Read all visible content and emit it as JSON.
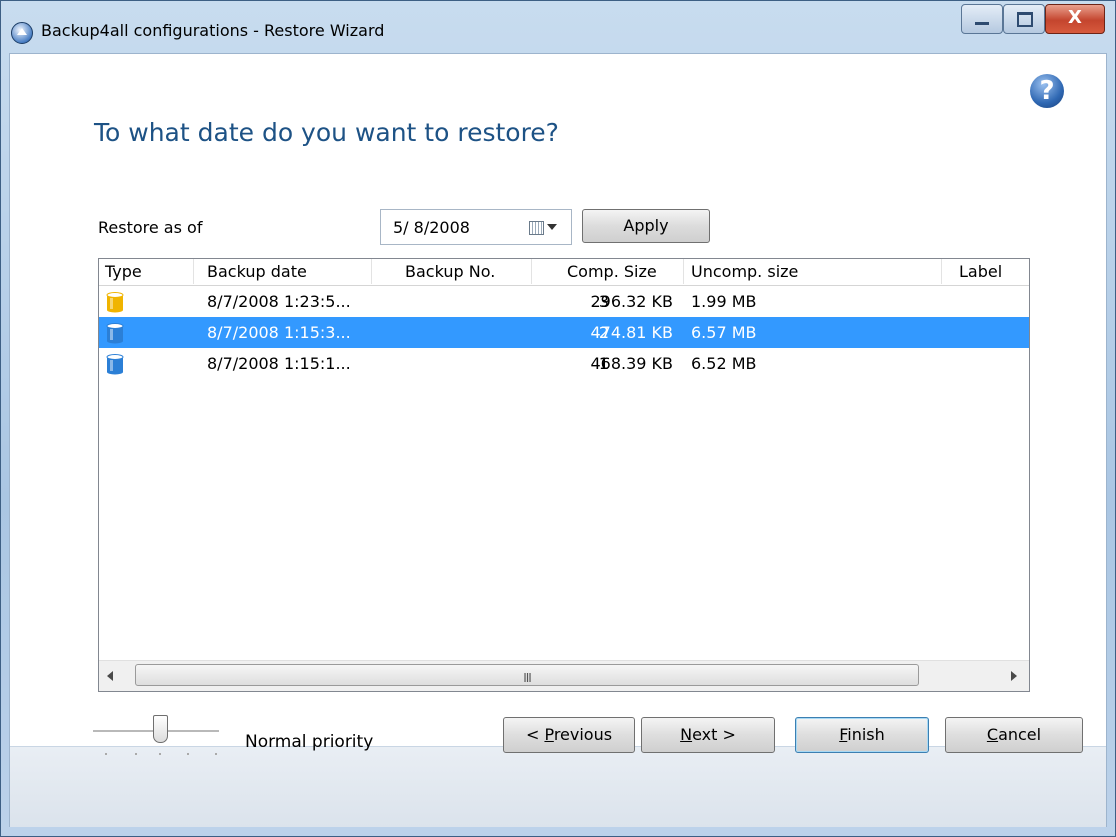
{
  "window": {
    "title": "Backup4all configurations - Restore Wizard",
    "close_symbol": "X"
  },
  "help": {
    "symbol": "?"
  },
  "page": {
    "heading": "To what date do you want to restore?"
  },
  "restore": {
    "label": "Restore as of",
    "date_value": "5/ 8/2008",
    "apply_label": "Apply"
  },
  "list": {
    "columns": [
      "Type",
      "Backup date",
      "Backup No.",
      "Comp. Size",
      "Uncomp. size",
      "Label"
    ],
    "rows": [
      {
        "type_icon": "database-icon",
        "backup_date": "8/7/2008 1:23:5...",
        "backup_no": "3",
        "comp_size": "296.32 KB",
        "uncomp_size": "1.99 MB",
        "label": "",
        "selected": false,
        "icon_color": "#f0b400"
      },
      {
        "type_icon": "database-icon",
        "backup_date": "8/7/2008 1:15:3...",
        "backup_no": "2",
        "comp_size": "474.81 KB",
        "uncomp_size": "6.57 MB",
        "label": "",
        "selected": true,
        "icon_color": "#2b7fd6"
      },
      {
        "type_icon": "database-icon",
        "backup_date": "8/7/2008 1:15:1...",
        "backup_no": "1",
        "comp_size": "468.39 KB",
        "uncomp_size": "6.52 MB",
        "label": "",
        "selected": false,
        "icon_color": "#2b7fd6"
      }
    ],
    "scroll_grip": "III"
  },
  "footer": {
    "priority_label": "Normal priority",
    "previous_prefix": "< ",
    "previous_key": "P",
    "previous_rest": "revious",
    "next_key": "N",
    "next_rest": "ext >",
    "finish_key": "F",
    "finish_rest": "inish",
    "cancel_key": "C",
    "cancel_rest": "ancel"
  },
  "colors": {
    "accent": "#1d5285",
    "selection": "#3399ff"
  }
}
